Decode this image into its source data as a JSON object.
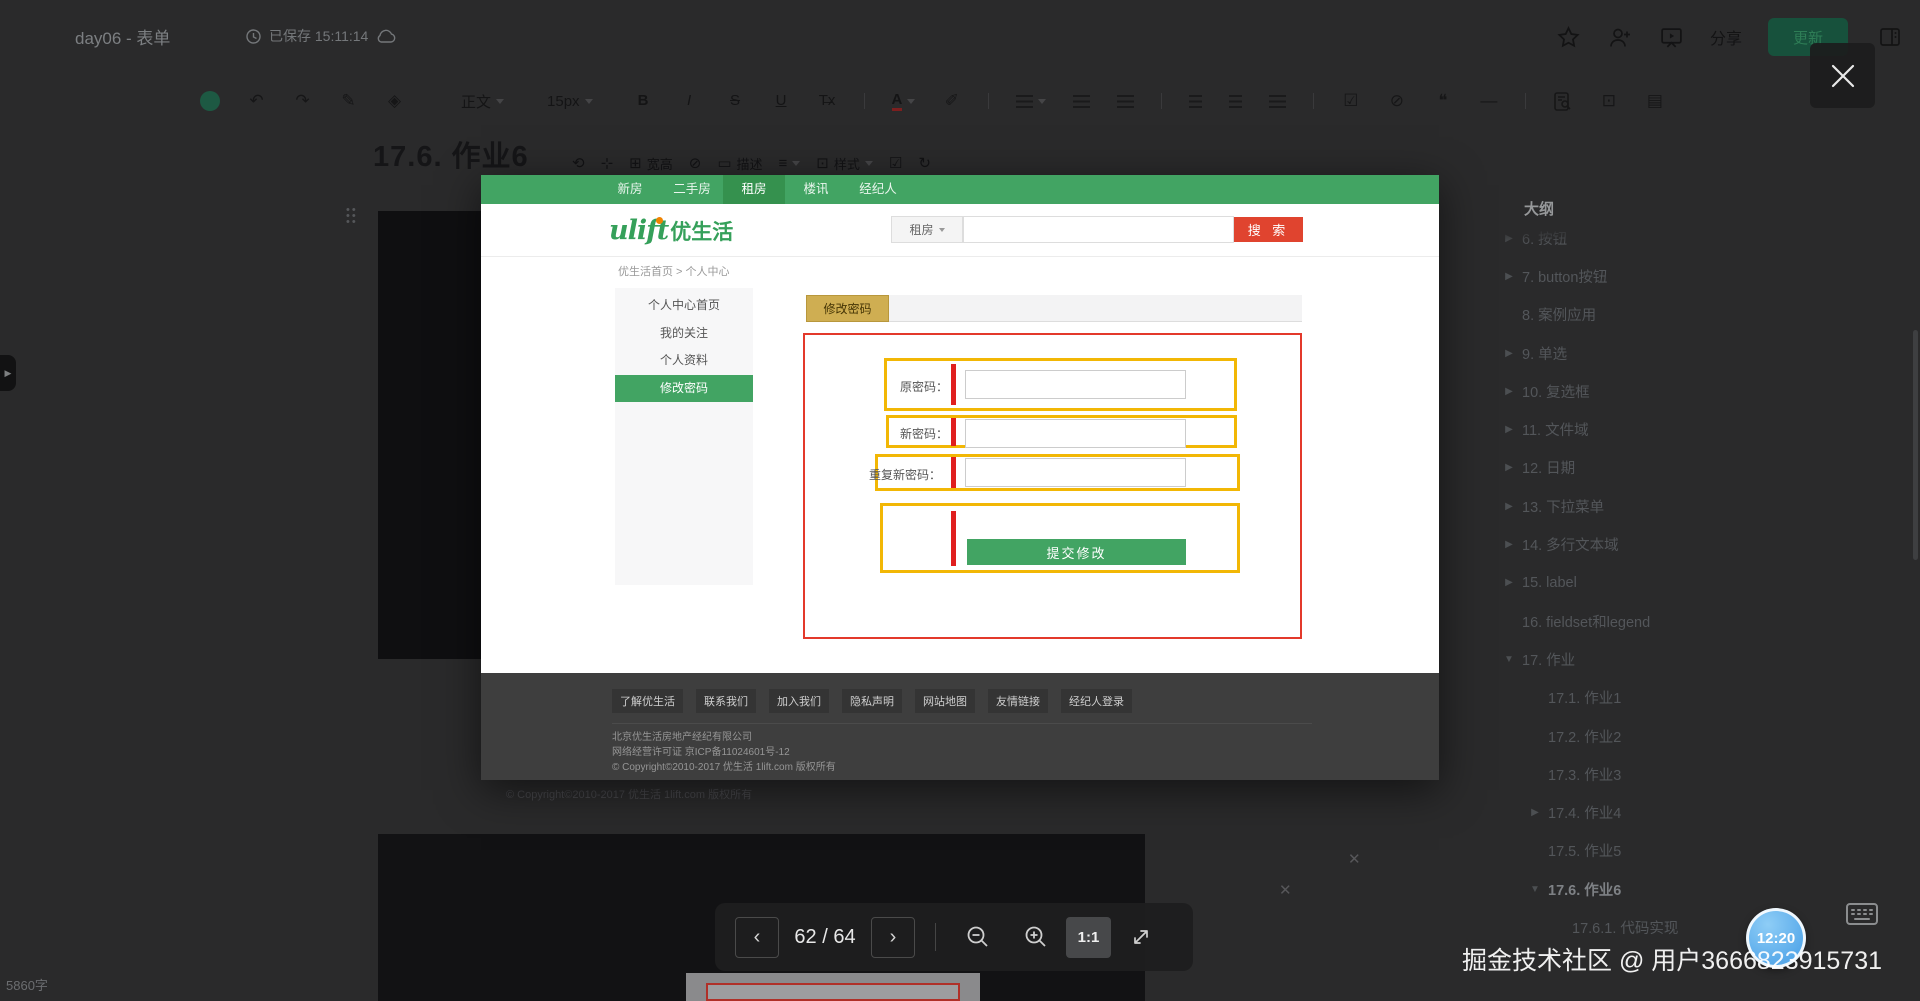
{
  "editor": {
    "topbar": {
      "title": "day06 - 表单",
      "save_status": "已保存 15:11:14",
      "share_label": "分享",
      "update_label": "更新"
    },
    "toolbar": {
      "paragraph_style": "正文",
      "font_size": "15px",
      "bold": "B",
      "italic": "I",
      "strike": "S",
      "underline": "U",
      "clear_format": "T̶x",
      "font_color": "A"
    },
    "image_toolbar": {
      "size_label": "宽高",
      "caption_label": "描述",
      "style_label": "样式"
    },
    "doc": {
      "heading": "17.6. 作业6",
      "faint_copyright": "© Copyright©2010-2017 优生活 1lift.com 版权所有",
      "word_count": "5860字"
    }
  },
  "outline": {
    "title": "大纲",
    "items": [
      {
        "label": "6. 按钮",
        "level": 1,
        "arrow": "right"
      },
      {
        "label": "7. button按钮",
        "level": 1,
        "arrow": "right"
      },
      {
        "label": "8. 案例应用",
        "level": 1,
        "arrow": ""
      },
      {
        "label": "9. 单选",
        "level": 1,
        "arrow": "right"
      },
      {
        "label": "10. 复选框",
        "level": 1,
        "arrow": "right"
      },
      {
        "label": "11. 文件域",
        "level": 1,
        "arrow": "right"
      },
      {
        "label": "12. 日期",
        "level": 1,
        "arrow": "right"
      },
      {
        "label": "13. 下拉菜单",
        "level": 1,
        "arrow": "right"
      },
      {
        "label": "14. 多行文本域",
        "level": 1,
        "arrow": "right"
      },
      {
        "label": "15. label",
        "level": 1,
        "arrow": "right"
      },
      {
        "label": "16. fieldset和legend",
        "level": 1,
        "arrow": ""
      },
      {
        "label": "17. 作业",
        "level": 1,
        "arrow": "down"
      },
      {
        "label": "17.1. 作业1",
        "level": 2,
        "arrow": ""
      },
      {
        "label": "17.2. 作业2",
        "level": 2,
        "arrow": ""
      },
      {
        "label": "17.3. 作业3",
        "level": 2,
        "arrow": ""
      },
      {
        "label": "17.4. 作业4",
        "level": 2,
        "arrow": "right"
      },
      {
        "label": "17.5. 作业5",
        "level": 2,
        "arrow": ""
      },
      {
        "label": "17.6. 作业6",
        "level": 2,
        "arrow": "down",
        "current": true
      },
      {
        "label": "17.6.1. 代码实现",
        "level": 3,
        "arrow": ""
      }
    ]
  },
  "preview": {
    "nav_items": [
      {
        "label": "新房"
      },
      {
        "label": "二手房"
      },
      {
        "label": "租房",
        "active": true
      },
      {
        "label": "楼讯"
      },
      {
        "label": "经纪人"
      }
    ],
    "logo_latin": "ulift",
    "logo_cn": "优生活",
    "search_category": "租房",
    "search_button": "搜 索",
    "breadcrumb": "优生活首页 > 个人中心",
    "menu_items": [
      {
        "label": "个人中心首页"
      },
      {
        "label": "我的关注"
      },
      {
        "label": "个人资料"
      },
      {
        "label": "修改密码",
        "active": true
      }
    ],
    "tab_label": "修改密码",
    "form": {
      "labels": [
        "原密码：",
        "新密码：",
        "重复新密码："
      ],
      "submit_label": "提交修改"
    },
    "footer": {
      "links": [
        "了解优生活",
        "联系我们",
        "加入我们",
        "隐私声明",
        "网站地图",
        "友情链接",
        "经纪人登录"
      ],
      "lines": [
        "北京优生活房地产经纪有限公司",
        "网络经营许可证 京ICP备11024601号-12",
        "© Copyright©2010-2017 优生活 1lift.com 版权所有"
      ]
    }
  },
  "viewer": {
    "page_indicator": "62 / 64",
    "scale_label": "1:1"
  },
  "watermark": "掘金技术社区 @ 用户3666823915731",
  "clock_time": "12:20",
  "colors": {
    "brand_green": "#42a463",
    "annotation_red": "#e3392b",
    "annotation_yellow": "#f2b705",
    "search_red": "#e0442f"
  }
}
